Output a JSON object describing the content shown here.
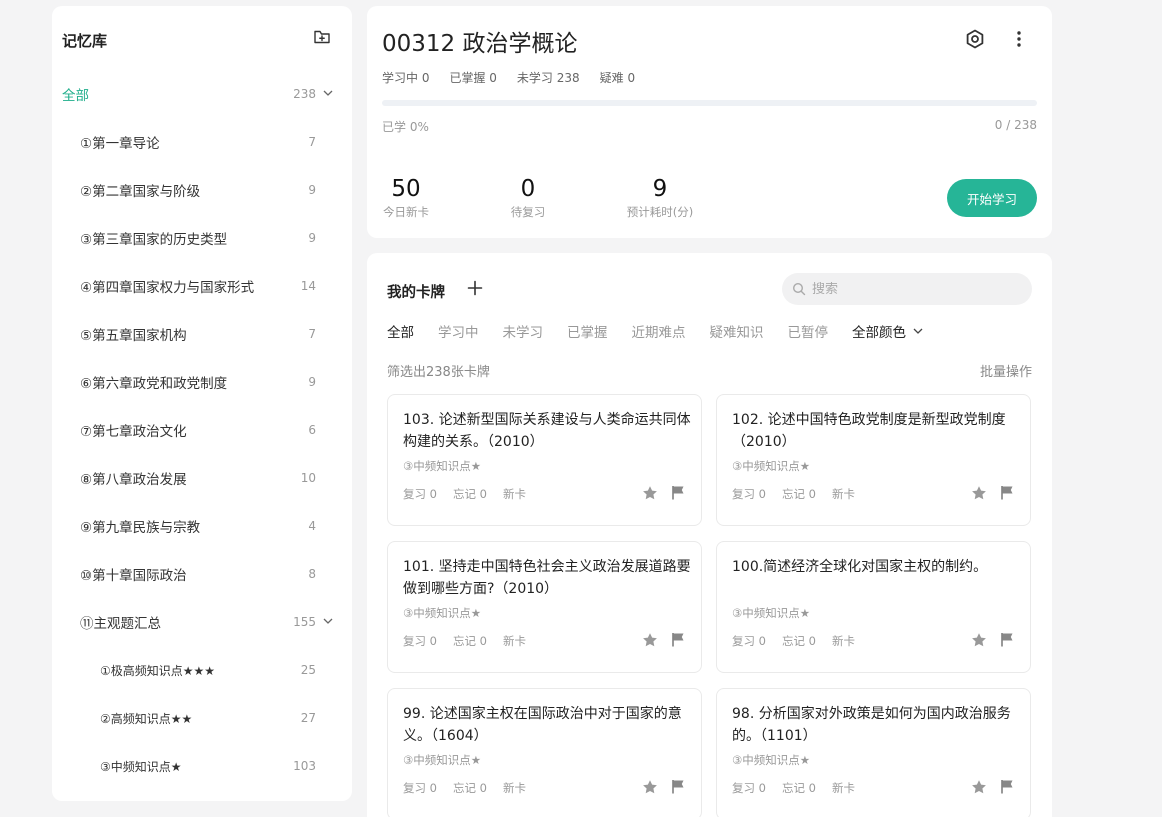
{
  "sidebar": {
    "title": "记忆库",
    "items": [
      {
        "label": "全部",
        "count": "238"
      },
      {
        "label": "①第一章导论",
        "count": "7"
      },
      {
        "label": "②第二章国家与阶级",
        "count": "9"
      },
      {
        "label": "③第三章国家的历史类型",
        "count": "9"
      },
      {
        "label": "④第四章国家权力与国家形式",
        "count": "14"
      },
      {
        "label": "⑤第五章国家机构",
        "count": "7"
      },
      {
        "label": "⑥第六章政党和政党制度",
        "count": "9"
      },
      {
        "label": "⑦第七章政治文化",
        "count": "6"
      },
      {
        "label": "⑧第八章政治发展",
        "count": "10"
      },
      {
        "label": "⑨第九章民族与宗教",
        "count": "4"
      },
      {
        "label": "⑩第十章国际政治",
        "count": "8"
      },
      {
        "label": "⑪主观题汇总",
        "count": "155"
      },
      {
        "label": "①极高频知识点★★★",
        "count": "25"
      },
      {
        "label": "②高频知识点★★",
        "count": "27"
      },
      {
        "label": "③中频知识点★",
        "count": "103"
      }
    ]
  },
  "deck": {
    "title": "00312 政治学概论",
    "stats": {
      "learning": "学习中 0",
      "mastered": "已掌握 0",
      "unlearned": "未学习 238",
      "difficult": "疑难 0"
    },
    "progress_fraction": 0,
    "learned_text": "已学 0%",
    "ratio_text": "0 / 238",
    "new_today": {
      "value": "50",
      "label": "今日新卡"
    },
    "to_review": {
      "value": "0",
      "label": "待复习"
    },
    "est_time": {
      "value": "9",
      "label": "预计耗时(分)"
    },
    "start_label": "开始学习"
  },
  "cards_panel": {
    "title": "我的卡牌",
    "search_placeholder": "搜索",
    "filters": [
      "全部",
      "学习中",
      "未学习",
      "已掌握",
      "近期难点",
      "疑难知识",
      "已暂停"
    ],
    "color_filter": "全部颜色",
    "filtered_text": "筛选出238张卡牌",
    "batch_label": "批量操作",
    "cards": [
      {
        "question": "103. 论述新型国际关系建设与人类命运共同体构建的关系。（2010）",
        "tag": "③中频知识点★",
        "review": "复习 0",
        "forget": "忘记 0",
        "status": "新卡"
      },
      {
        "question": "102. 论述中国特色政党制度是新型政党制度（2010）",
        "tag": "③中频知识点★",
        "review": "复习 0",
        "forget": "忘记 0",
        "status": "新卡"
      },
      {
        "question": "101. 坚持走中国特色社会主义政治发展道路要做到哪些方面?（2010）",
        "tag": "③中频知识点★",
        "review": "复习 0",
        "forget": "忘记 0",
        "status": "新卡"
      },
      {
        "question": "100.简述经济全球化对国家主权的制约。",
        "tag": "③中频知识点★",
        "review": "复习 0",
        "forget": "忘记 0",
        "status": "新卡"
      },
      {
        "question": "99. 论述国家主权在国际政治中对于国家的意义。（1604）",
        "tag": "③中频知识点★",
        "review": "复习 0",
        "forget": "忘记 0",
        "status": "新卡"
      },
      {
        "question": "98. 分析国家对外政策是如何为国内政治服务的。（1101）",
        "tag": "③中频知识点★",
        "review": "复习 0",
        "forget": "忘记 0",
        "status": "新卡"
      }
    ]
  },
  "colors": {
    "accent": "#1fae8b",
    "button": "#26b597"
  }
}
